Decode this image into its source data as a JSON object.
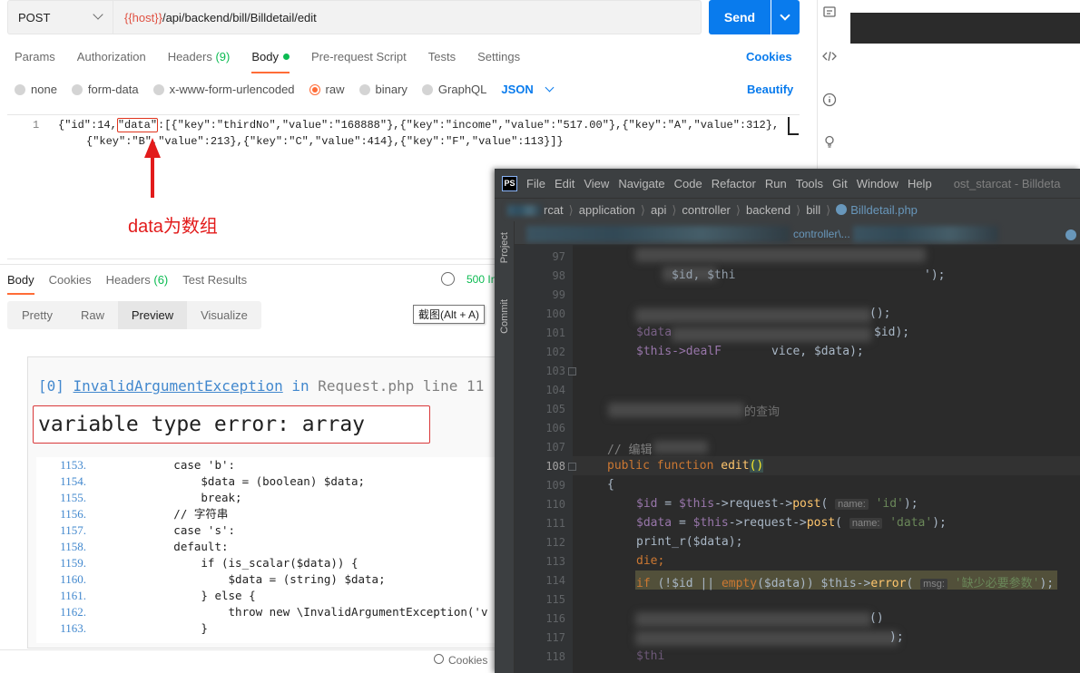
{
  "postman": {
    "method": "POST",
    "url_var": "{{host}}",
    "url_path": "/api/backend/bill/Billdetail/edit",
    "send_label": "Send",
    "tabs": [
      {
        "label": "Params"
      },
      {
        "label": "Authorization"
      },
      {
        "label": "Headers",
        "count": "(9)"
      },
      {
        "label": "Body"
      },
      {
        "label": "Pre-request Script"
      },
      {
        "label": "Tests"
      },
      {
        "label": "Settings"
      }
    ],
    "cookies_label": "Cookies",
    "body_modes": [
      "none",
      "form-data",
      "x-www-form-urlencoded",
      "raw",
      "binary",
      "GraphQL"
    ],
    "selected_mode": "raw",
    "format": "JSON",
    "beautify_label": "Beautify",
    "editor_line_number": "1",
    "json_line1": {
      "p1": "{\"id\":14,",
      "data_key": "\"data\"",
      "p2": ":[{\"key\":\"thirdNo\",\"value\":\"168888\"},{\"key\":\"income\",\"value\":\"517.00\"},{\"key\":\"A\",\"value\":312},"
    },
    "json_line2": "{\"key\":\"B\",\"value\":213},{\"key\":\"C\",\"value\":414},{\"key\":\"F\",\"value\":113}]}",
    "annotation": "data为数组",
    "response_tabs": [
      {
        "label": "Body"
      },
      {
        "label": "Cookies"
      },
      {
        "label": "Headers",
        "count": "(6)"
      },
      {
        "label": "Test Results"
      }
    ],
    "status_text": "500 In",
    "view_modes": [
      "Pretty",
      "Raw",
      "Preview",
      "Visualize"
    ],
    "active_view": "Preview",
    "tooltip": "截图(Alt + A)",
    "footer_cookies": "Cookies"
  },
  "preview": {
    "exception_index": "[0]",
    "exception_class": "InvalidArgumentException",
    "in_word": "in",
    "file": "Request.php",
    "line_label": "line 11",
    "error_message": "variable type error: array",
    "source_lines": [
      {
        "num": "1153.",
        "code": "            case 'b':"
      },
      {
        "num": "1154.",
        "code": "                $data = (boolean) $data;"
      },
      {
        "num": "1155.",
        "code": "                break;"
      },
      {
        "num": "1156.",
        "code": "            // 字符串"
      },
      {
        "num": "1157.",
        "code": "            case 's':"
      },
      {
        "num": "1158.",
        "code": "            default:"
      },
      {
        "num": "1159.",
        "code": "                if (is_scalar($data)) {"
      },
      {
        "num": "1160.",
        "code": "                    $data = (string) $data;"
      },
      {
        "num": "1161.",
        "code": "                } else {"
      },
      {
        "num": "1162.",
        "code": "                    throw new \\InvalidArgumentException('v"
      },
      {
        "num": "1163.",
        "code": "                }"
      }
    ]
  },
  "ide": {
    "logo": "PS",
    "menus": [
      "File",
      "Edit",
      "View",
      "Navigate",
      "Code",
      "Refactor",
      "Run",
      "Tools",
      "Git",
      "Window",
      "Help"
    ],
    "project_title": "ost_starcat - Billdeta",
    "breadcrumb": [
      "rcat",
      "application",
      "api",
      "controller",
      "backend",
      "bill"
    ],
    "breadcrumb_file": "Billdetail.php",
    "tab_fragment": "controller\\...",
    "side_tabs": [
      "Project",
      "Commit"
    ],
    "line_numbers": [
      "97",
      "98",
      "99",
      "100",
      "101",
      "102",
      "103",
      "104",
      "105",
      "106",
      "107",
      "108",
      "109",
      "110",
      "111",
      "112",
      "113",
      "114",
      "115",
      "116",
      "117",
      "118"
    ],
    "code": {
      "l98a": "$id, $thi",
      "l98b": "');",
      "l100": "();",
      "l101a": "$data",
      "l101b": "$id);",
      "l102a": "$this->dealF",
      "l102b": "vice, $data);",
      "l105": "的查询",
      "l107": "// 编辑",
      "l108_kw1": "public",
      "l108_kw2": "function",
      "l108_fn": "edit",
      "l108_paren": "()",
      "l109": "{",
      "l110_var": "$id",
      "l110_eq": " = ",
      "l110_this": "$this",
      "l110_req": "->request->",
      "l110_fn": "post",
      "l110_hint": "name:",
      "l110_str": "'id'",
      "l110_end": ");",
      "l111_var": "$data",
      "l111_str": "'data'",
      "l112": "print_r($data);",
      "l113": "die;",
      "l114_if": "if",
      "l114_a": " (!$id || ",
      "l114_empty": "empty",
      "l114_b": "($data)) $this->",
      "l114_fn": "error",
      "l114_hint": "msg:",
      "l114_str": "'缺少必要参数'",
      "l114_end": ");",
      "l116": "()",
      "l117": ");",
      "l118": "$thi"
    }
  }
}
